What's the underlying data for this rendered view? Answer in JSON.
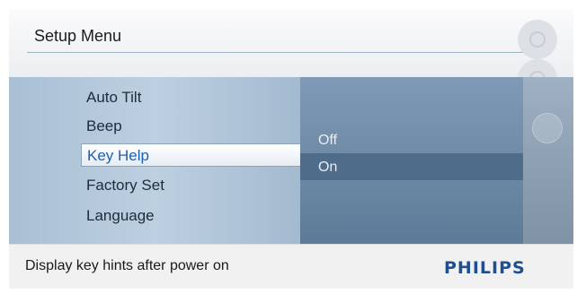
{
  "header": {
    "title": "Setup Menu"
  },
  "menu": {
    "items": [
      {
        "label": "Auto Tilt"
      },
      {
        "label": "Beep"
      },
      {
        "label": "Key Help",
        "selected": true
      },
      {
        "label": "Factory Set"
      },
      {
        "label": "Language"
      }
    ]
  },
  "options": {
    "items": [
      {
        "label": "Off"
      },
      {
        "label": "On",
        "selected": true
      }
    ]
  },
  "footer": {
    "hint": "Display key hints after power on",
    "brand": "PHILIPS"
  },
  "icons": [
    "settings-gear-icon",
    "scroll-up-icon",
    "scroll-down-icon"
  ],
  "colors": {
    "brand": "#1f4f8f",
    "selected_text": "#1e5fae",
    "panel_dark": "#5d7b98"
  }
}
